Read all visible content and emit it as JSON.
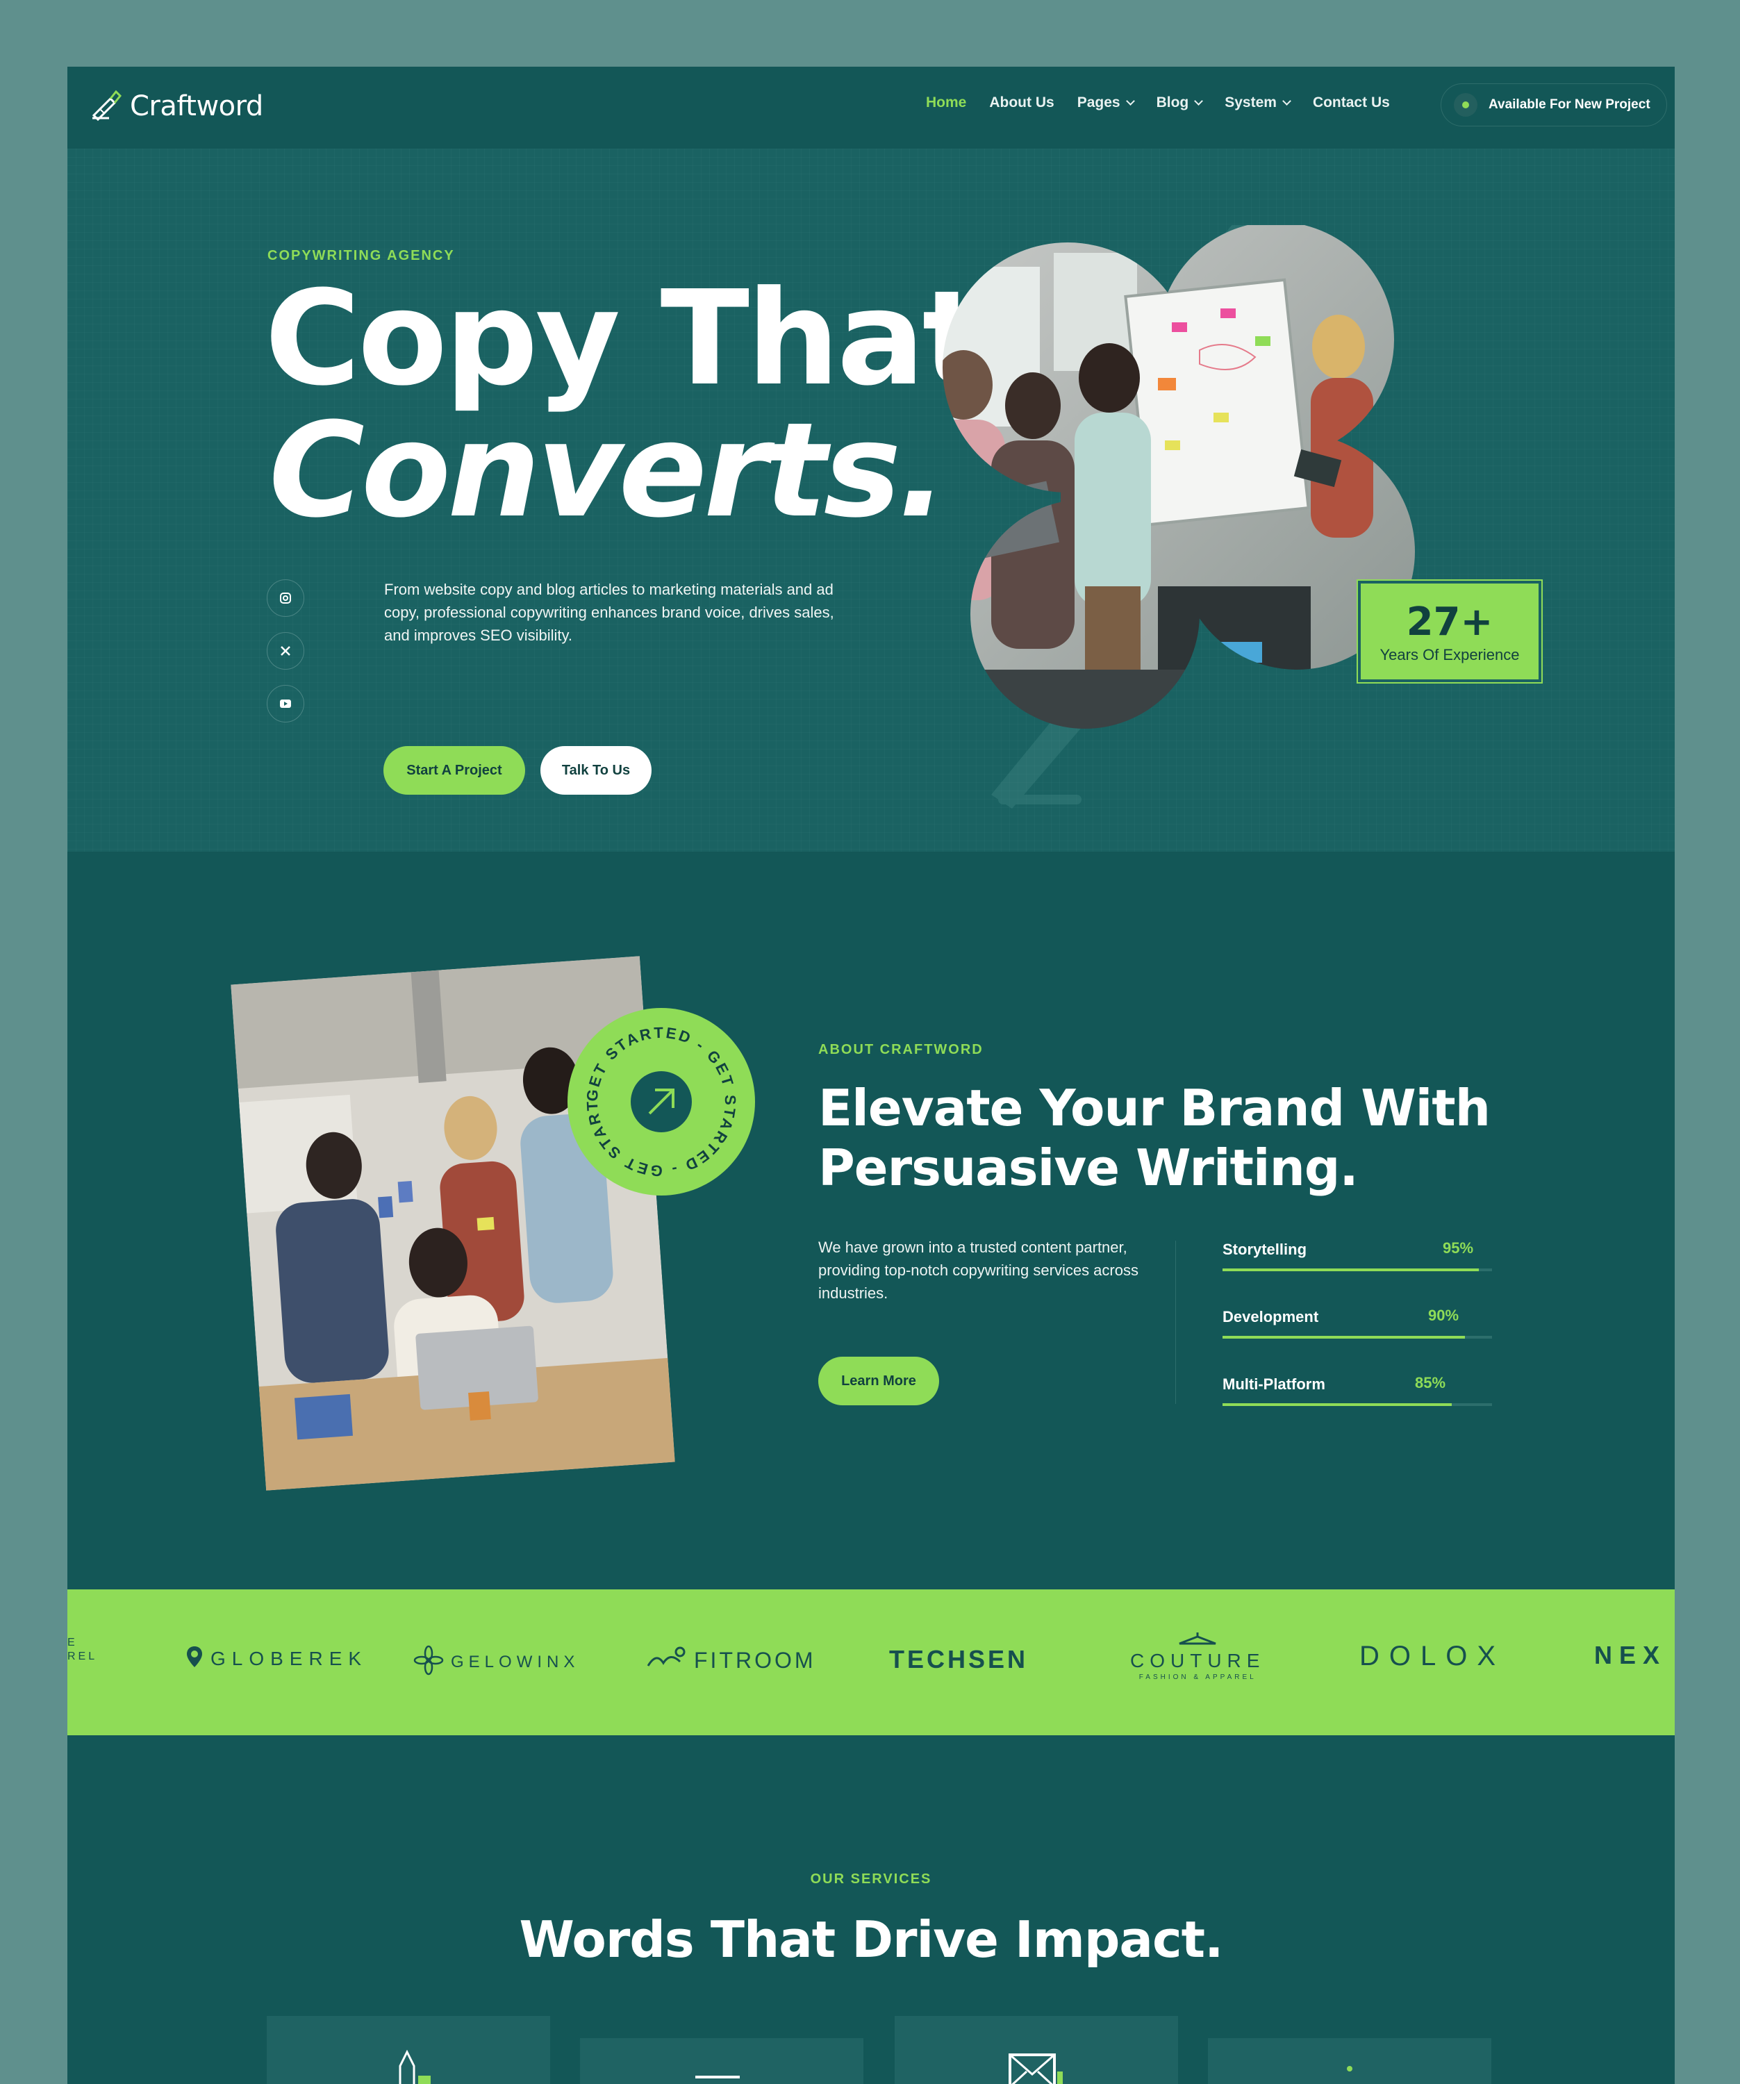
{
  "brand": {
    "name": "Craftword"
  },
  "nav": {
    "items": [
      {
        "label": "Home",
        "active": true,
        "dropdown": false
      },
      {
        "label": "About Us",
        "active": false,
        "dropdown": false
      },
      {
        "label": "Pages",
        "active": false,
        "dropdown": true
      },
      {
        "label": "Blog",
        "active": false,
        "dropdown": true
      },
      {
        "label": "System",
        "active": false,
        "dropdown": true
      },
      {
        "label": "Contact Us",
        "active": false,
        "dropdown": false
      }
    ],
    "availability": "Available For New Project"
  },
  "hero": {
    "eyebrow": "COPYWRITING AGENCY",
    "title_line1": "Copy That",
    "title_line2": "Converts.",
    "description": "From website copy and blog articles to marketing materials and ad copy, professional copywriting enhances brand voice, drives sales, and improves SEO visibility.",
    "cta_primary": "Start A Project",
    "cta_secondary": "Talk To Us",
    "socials": [
      "instagram-icon",
      "x-icon",
      "youtube-icon"
    ],
    "experience_value": "27+",
    "experience_label": "Years Of Experience"
  },
  "about": {
    "eyebrow": "ABOUT CRAFTWORD",
    "title_line1": "Elevate Your Brand With",
    "title_line2": "Persuasive Writing.",
    "description": "We have grown into a trusted content partner, providing top-notch copywriting services across industries.",
    "cta": "Learn More",
    "badge_text": "GET STARTED - GET STARTED - GET STARTED - ",
    "skills": [
      {
        "name": "Storytelling",
        "percent_label": "95%",
        "value": 95
      },
      {
        "name": "Development",
        "percent_label": "90%",
        "value": 90
      },
      {
        "name": "Multi-Platform",
        "percent_label": "85%",
        "value": 85
      }
    ]
  },
  "logos": {
    "items": [
      {
        "partial_top": "E",
        "partial_bottom": "REL"
      },
      {
        "name": "GLOBEREK"
      },
      {
        "name": "GELOWINX"
      },
      {
        "name": "FITROOM"
      },
      {
        "name": "TECHSEN"
      },
      {
        "name": "COUTURE",
        "tagline": "FASHION & APPAREL"
      },
      {
        "name": "DOLOX"
      },
      {
        "name": "NEX"
      }
    ]
  },
  "services": {
    "eyebrow": "OUR SERVICES",
    "title": "Words That Drive Impact."
  },
  "colors": {
    "outer_background": "#5f908d",
    "page_background": "#135757",
    "hero_background": "#1a6262",
    "accent": "#8fdc57",
    "dark_text": "#11413f",
    "white": "#ffffff"
  }
}
